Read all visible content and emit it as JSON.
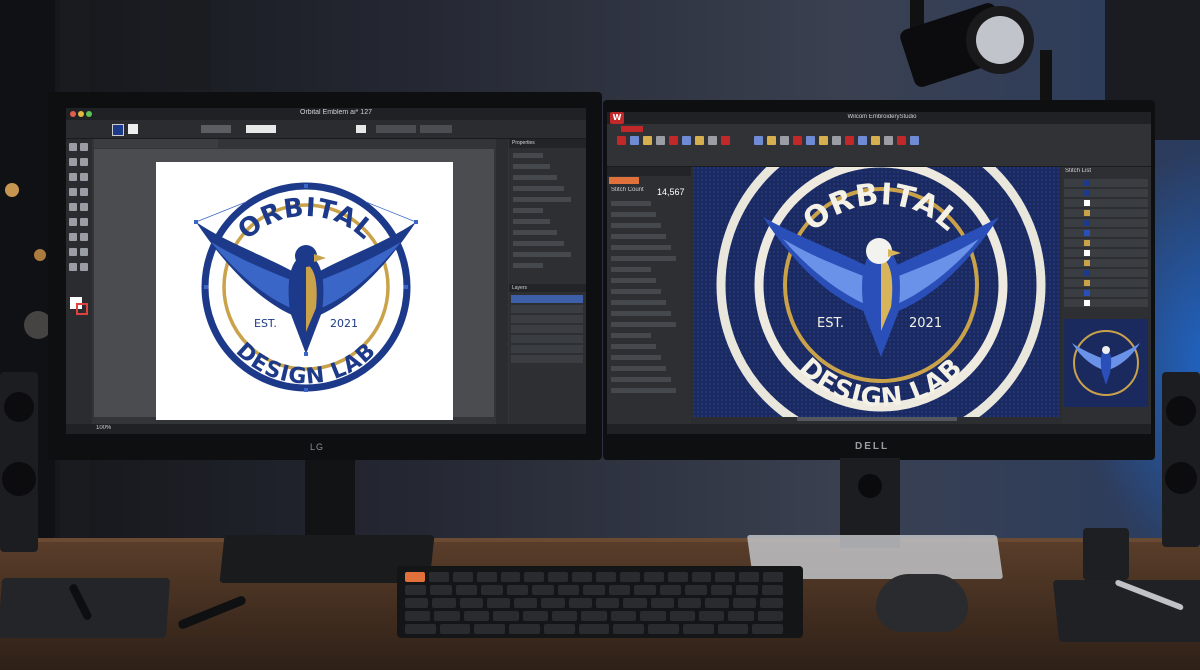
{
  "colors": {
    "wall": "#2a2e3a",
    "desk": "#4a3324",
    "navy": "#1d3a8a",
    "gold": "#c9a24a",
    "fabric": "#1b2a5e",
    "accent_orange": "#e0713a",
    "ui_dark": "#2b2d31"
  },
  "left_monitor": {
    "brand": "LG",
    "app_title": "Orbital Emblem ai* 127",
    "properties_tab": "Properties",
    "layers_tab": "Layers",
    "zoom_value": "100%",
    "logo": {
      "top_text": "ORBITAL",
      "bottom_text": "DESIGN LAB",
      "est_label": "EST.",
      "year": "2021"
    }
  },
  "right_monitor": {
    "brand": "DELL",
    "app_title": "Wilcom EmbroideryStudio",
    "app_icon_letter": "W",
    "object_panel_title": "Stitch Count",
    "stitch_value": "14,567",
    "stitch_list_title": "Stitch List",
    "patch": {
      "top_text": "ORBITAL",
      "bottom_text": "DESIGN LAB",
      "est_label": "EST.",
      "year": "2021"
    }
  }
}
